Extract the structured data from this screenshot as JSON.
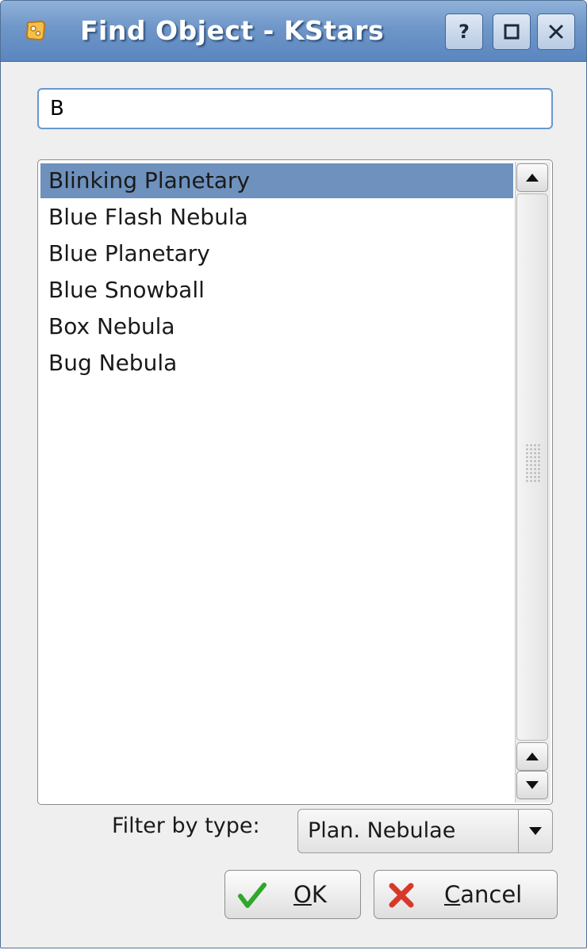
{
  "window": {
    "title": "Find Object - KStars",
    "controls": {
      "help": "?",
      "maximize": "□",
      "close": "✕"
    }
  },
  "search": {
    "value": "B"
  },
  "results": {
    "items": [
      "Blinking Planetary",
      "Blue Flash Nebula",
      "Blue Planetary",
      "Blue Snowball",
      "Box Nebula",
      "Bug Nebula"
    ],
    "selected_index": 0
  },
  "filter": {
    "label": "Filter by type:",
    "value": "Plan. Nebulae"
  },
  "buttons": {
    "ok": {
      "mnemonic": "O",
      "rest": "K"
    },
    "cancel": {
      "mnemonic": "C",
      "rest": "ancel"
    }
  },
  "colors": {
    "titlebar": "#6f96c8",
    "selection": "#6e91bd",
    "ok_check": "#2fa82a",
    "cancel_x": "#d8382a"
  },
  "icons": {
    "app": "kstars-app-icon",
    "help": "help-icon",
    "maximize": "maximize-icon",
    "close": "close-icon",
    "ok": "checkmark-icon",
    "cancel": "x-mark-icon"
  }
}
